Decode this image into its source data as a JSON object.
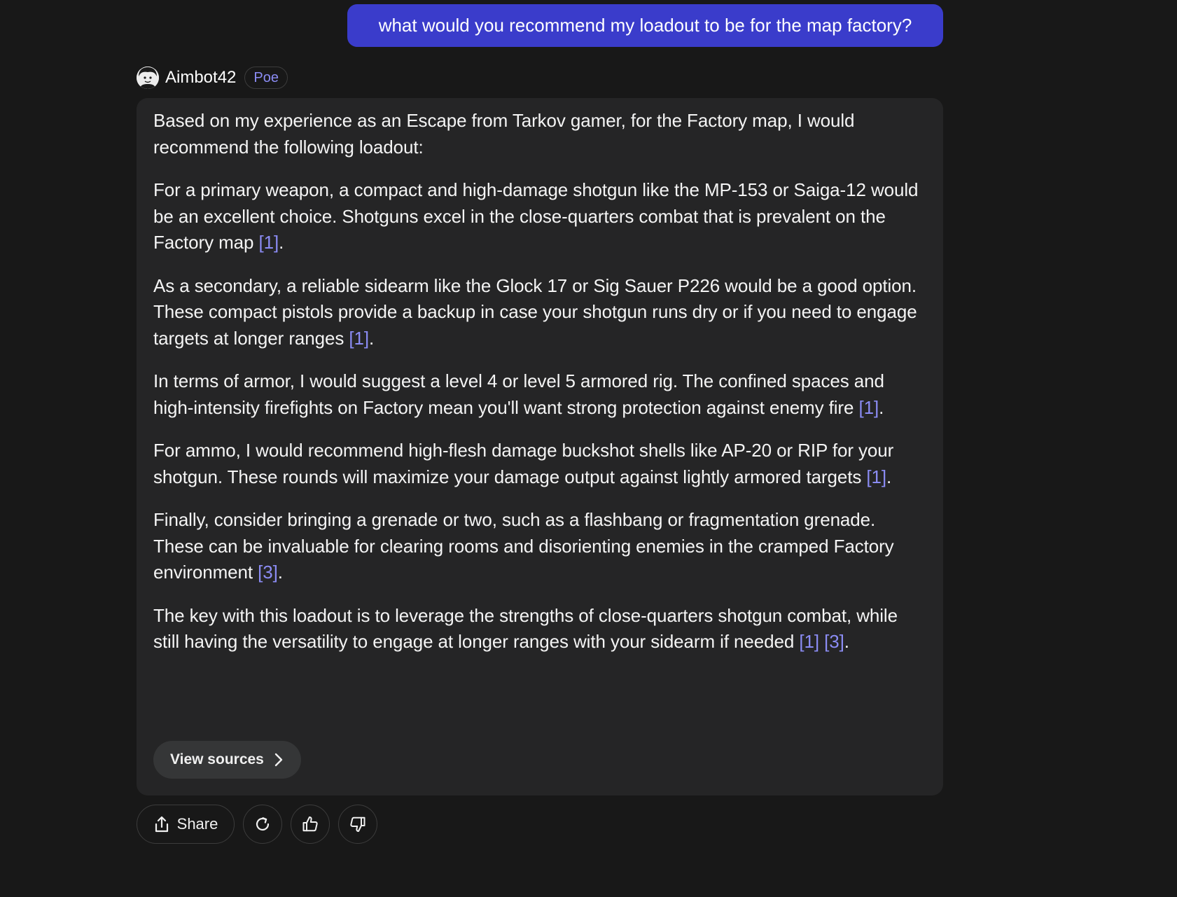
{
  "user_message": "what would you recommend my loadout to be for the map factory?",
  "bot": {
    "name": "Aimbot42",
    "badge": "Poe"
  },
  "response": {
    "p1": {
      "text": "Based on my experience as an Escape from Tarkov gamer, for the Factory map, I would recommend the following loadout:"
    },
    "p2": {
      "text": "For a primary weapon, a compact and high-damage shotgun like the MP-153 or Saiga-12 would be an excellent choice. Shotguns excel in the close-quarters combat that is prevalent on the Factory map ",
      "cite1": "[1]",
      "end": "."
    },
    "p3": {
      "text": "As a secondary, a reliable sidearm like the Glock 17 or Sig Sauer P226 would be a good option. These compact pistols provide a backup in case your shotgun runs dry or if you need to engage targets at longer ranges ",
      "cite1": "[1]",
      "end": "."
    },
    "p4": {
      "text": "In terms of armor, I would suggest a level 4 or level 5 armored rig. The confined spaces and high-intensity firefights on Factory mean you'll want strong protection against enemy fire ",
      "cite1": "[1]",
      "end": "."
    },
    "p5": {
      "text": "For ammo, I would recommend high-flesh damage buckshot shells like AP-20 or RIP for your shotgun. These rounds will maximize your damage output against lightly armored targets ",
      "cite1": "[1]",
      "end": "."
    },
    "p6": {
      "text": "Finally, consider bringing a grenade or two, such as a flashbang or fragmentation grenade. These can be invaluable for clearing rooms and disorienting enemies in the cramped Factory environment ",
      "cite1": "[3]",
      "end": "."
    },
    "p7": {
      "text": "The key with this loadout is to leverage the strengths of close-quarters shotgun combat, while still having the versatility to engage at longer ranges with your sidearm if needed ",
      "cite1": "[1]",
      "sep": " ",
      "cite2": "[3]",
      "end": "."
    }
  },
  "view_sources_label": "View sources",
  "actions": {
    "share_label": "Share"
  },
  "colors": {
    "background": "#181818",
    "user_bubble": "#3a3ccb",
    "card": "#252526",
    "citation": "#8b8cf4"
  },
  "icons": [
    "avatar-face-icon",
    "chevron-right-icon",
    "share-icon",
    "refresh-icon",
    "thumbs-up-icon",
    "thumbs-down-icon"
  ]
}
